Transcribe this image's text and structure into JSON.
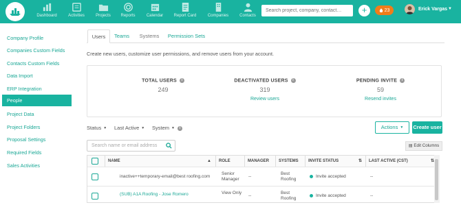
{
  "nav": {
    "items": [
      {
        "label": "Dashboard",
        "icon": "bar-chart-icon"
      },
      {
        "label": "Activities",
        "icon": "calendar-list-icon"
      },
      {
        "label": "Projects",
        "icon": "folder-icon"
      },
      {
        "label": "Reports",
        "icon": "target-icon"
      },
      {
        "label": "Calendar",
        "icon": "calendar-icon"
      },
      {
        "label": "Report Card",
        "icon": "report-card-icon"
      },
      {
        "label": "Companies",
        "icon": "building-icon"
      },
      {
        "label": "Contacts",
        "icon": "person-icon"
      }
    ],
    "search_placeholder": "Search project, company, contact…",
    "notifications": "23",
    "user_name": "Erick Vargas"
  },
  "sidebar": {
    "items": [
      "Company Profile",
      "Companies Custom Fields",
      "Contacts Custom Fields",
      "Data Import",
      "ERP Integration",
      "People",
      "Project Data",
      "Project Folders",
      "Proposal Settings",
      "Required Fields",
      "Sales Activities"
    ],
    "active": "People"
  },
  "tabs": [
    "Users",
    "Teams",
    "Systems",
    "Permission Sets"
  ],
  "description": "Create new users, customize user permissions, and remove users from your account.",
  "stats": {
    "total": {
      "label": "TOTAL USERS",
      "value": "249"
    },
    "deactivated": {
      "label": "DEACTIVATED USERS",
      "value": "319",
      "link": "Review users"
    },
    "pending": {
      "label": "PENDING INVITE",
      "value": "59",
      "link": "Resend invites"
    }
  },
  "filters": {
    "status": "Status",
    "last_active": "Last Active",
    "system": "System"
  },
  "buttons": {
    "actions": "Actions",
    "create_user": "Create user",
    "edit_columns": "Edit Columns"
  },
  "table_search_placeholder": "Search name or email address",
  "table": {
    "columns": [
      "NAME",
      "ROLE",
      "MANAGER",
      "SYSTEMS",
      "INVITE STATUS",
      "LAST ACTIVE (CST)"
    ],
    "rows": [
      {
        "name": "inactive++temporary-email@best roofing.com",
        "role": "Senior Manager",
        "manager": "--",
        "systems": "Best Roofing",
        "invite_status": "Invite accepted",
        "last_active": "--"
      },
      {
        "name": "(SUB) A1A Roofing - Jose Romero",
        "role": "View Only",
        "manager": "--",
        "systems": "Best Roofing",
        "invite_status": "Invite accepted",
        "last_active": "--"
      }
    ]
  },
  "colors": {
    "brand": "#19b3a0",
    "badge": "#f07d1a"
  }
}
